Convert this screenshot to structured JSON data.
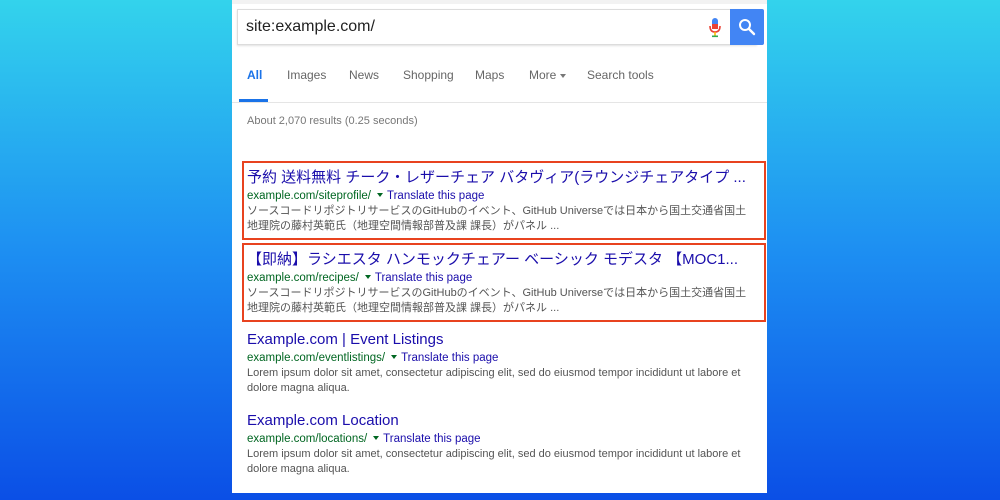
{
  "search": {
    "query": "site:example.com/"
  },
  "tabs": [
    {
      "label": "All"
    },
    {
      "label": "Images"
    },
    {
      "label": "News"
    },
    {
      "label": "Shopping"
    },
    {
      "label": "Maps"
    },
    {
      "label": "More"
    },
    {
      "label": "Search tools"
    }
  ],
  "stats": "About 2,070 results (0.25 seconds)",
  "results": [
    {
      "title": "予約 送料無料 チーク・レザーチェア バタヴィア(ラウンジチェアタイプ ...",
      "url": "example.com/siteprofile/",
      "translate": "Translate this page",
      "snippet": "ソースコードリポジトリサービスのGitHubのイベント、GitHub Universeでは日本から国土交通省国土地理院の藤村英範氏（地理空間情報部普及課 課長）がパネル ..."
    },
    {
      "title": "【即納】ラシエスタ ハンモックチェアー ベーシック モデスタ 【MOC1...",
      "url": "example.com/recipes/",
      "translate": "Translate this page",
      "snippet": "ソースコードリポジトリサービスのGitHubのイベント、GitHub Universeでは日本から国土交通省国土地理院の藤村英範氏（地理空間情報部普及課 課長）がパネル ..."
    },
    {
      "title": "Example.com | Event Listings",
      "url": "example.com/eventlistings/",
      "translate": "Translate this page",
      "snippet": "Lorem ipsum dolor sit amet, consectetur adipiscing elit, sed do eiusmod tempor incididunt ut labore et dolore magna aliqua."
    },
    {
      "title": "Example.com Location",
      "url": "example.com/locations/",
      "translate": "Translate this page",
      "snippet": "Lorem ipsum dolor sit amet, consectetur adipiscing elit, sed do eiusmod tempor incididunt ut labore et dolore magna aliqua."
    }
  ],
  "colors": {
    "background_top": "#33d3ec",
    "background_bottom": "#0b4fe6",
    "accent": "#4285f4",
    "link": "#1a0dab",
    "url_green": "#006621",
    "highlight_border": "#e8431f"
  },
  "icons": [
    "mic-icon",
    "search-icon",
    "chevron-down-icon"
  ]
}
